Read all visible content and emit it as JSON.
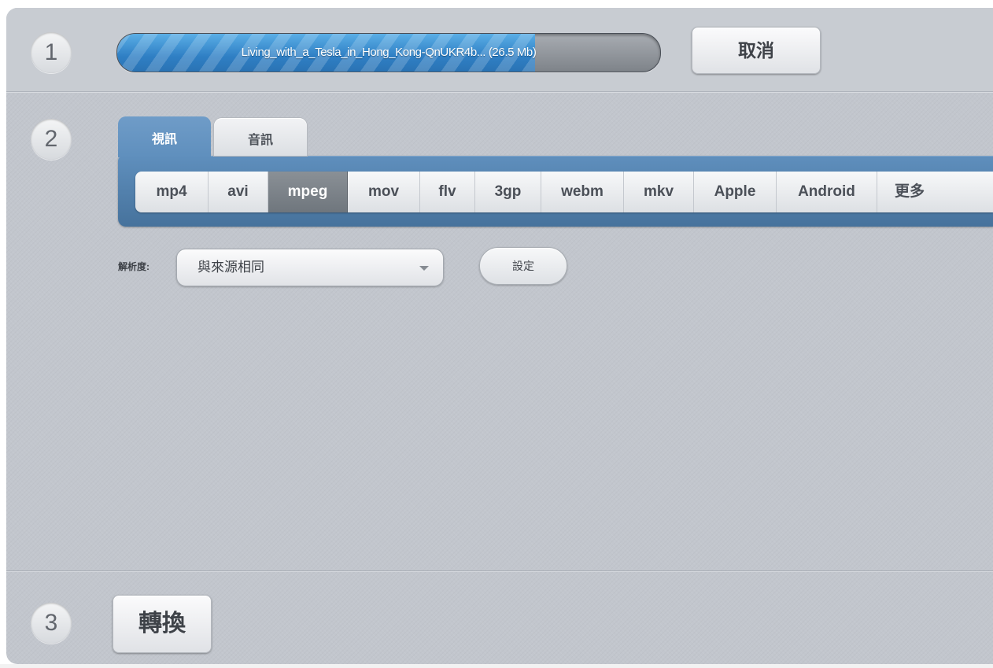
{
  "steps": {
    "one": "1",
    "two": "2",
    "three": "3"
  },
  "download": {
    "text": "Living_with_a_Tesla_in_Hong_Kong-QnUKR4b... (26.5 Mb)",
    "progress_percent": 77,
    "cancel_label": "取消"
  },
  "tabs": [
    {
      "label": "視訊",
      "active": true
    },
    {
      "label": "音訊",
      "active": false
    }
  ],
  "formats": [
    {
      "label": "mp4"
    },
    {
      "label": "avi"
    },
    {
      "label": "mpeg",
      "active": true
    },
    {
      "label": "mov"
    },
    {
      "label": "flv"
    },
    {
      "label": "3gp"
    },
    {
      "label": "webm"
    },
    {
      "label": "mkv"
    },
    {
      "label": "Apple"
    },
    {
      "label": "Android"
    },
    {
      "label": "更多"
    }
  ],
  "resolution": {
    "label": "解析度:",
    "value": "與來源相同",
    "settings_label": "設定"
  },
  "convert_label": "轉換",
  "colors": {
    "accent_blue": "#4f7fab",
    "progress_blue": "#3b8fd6",
    "panel_gray": "#c2c6cd"
  }
}
